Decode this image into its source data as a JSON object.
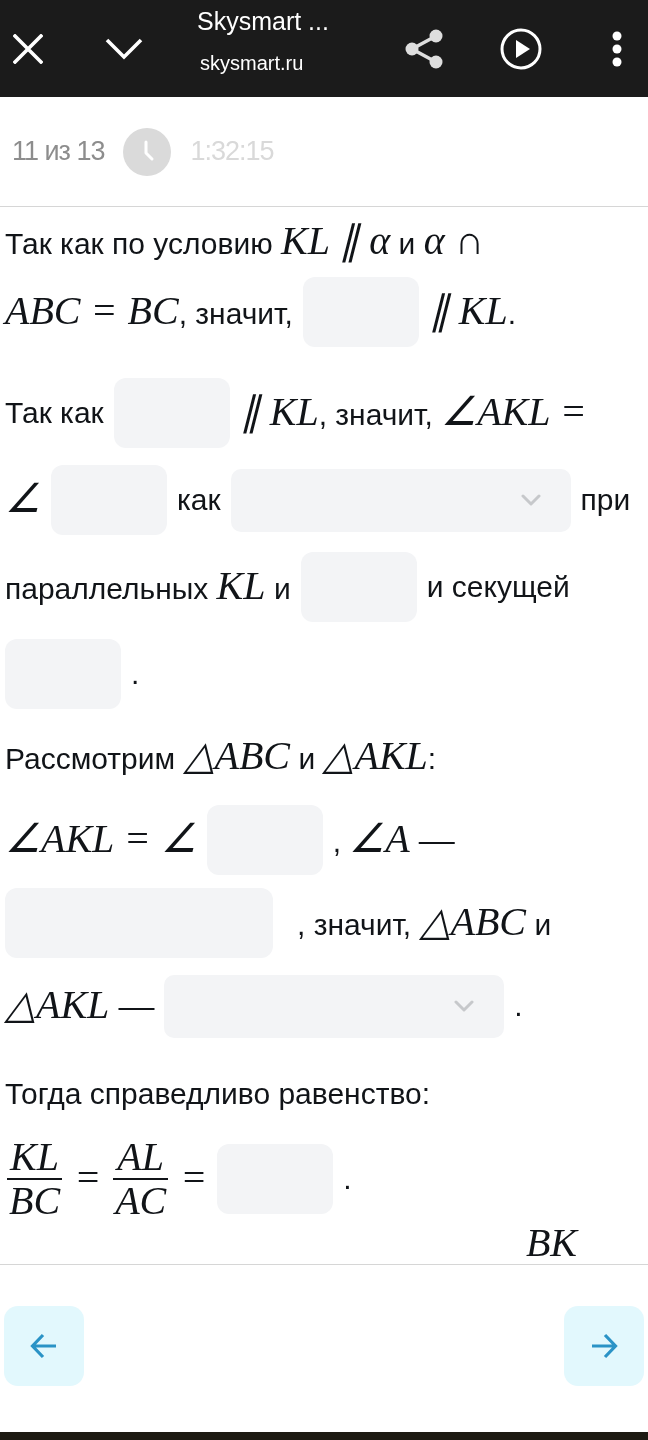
{
  "browser_bar": {
    "title": "Skysmart ...",
    "url": "skysmart.ru"
  },
  "progress": {
    "counter": "11 из 13",
    "timer": "1:32:15"
  },
  "task": {
    "paragraphs": [
      {
        "lines": [
          {
            "items": [
              {
                "kind": "text",
                "text": "Так как по условию *KL ∥ α* и *α ∩*"
              }
            ]
          },
          {
            "items": [
              {
                "kind": "text",
                "text": "*ABC = BC*, значит,"
              },
              {
                "kind": "field"
              },
              {
                "kind": "text",
                "text": "*∥ KL*."
              }
            ]
          }
        ]
      },
      {
        "lines": [
          {
            "items": [
              {
                "kind": "text",
                "text": "Так как"
              },
              {
                "kind": "field"
              },
              {
                "kind": "text",
                "text": "*∥ KL*, значит, *∠AKL =*"
              }
            ]
          },
          {
            "items": [
              {
                "kind": "text",
                "text": "*∠*"
              },
              {
                "kind": "field"
              },
              {
                "kind": "text",
                "text": "как"
              },
              {
                "kind": "select"
              },
              {
                "kind": "text",
                "text": "при"
              }
            ]
          },
          {
            "items": [
              {
                "kind": "text",
                "text": "параллельных *KL* и"
              },
              {
                "kind": "field"
              },
              {
                "kind": "text",
                "text": "и секущей"
              }
            ]
          },
          {
            "items": [
              {
                "kind": "field"
              },
              {
                "kind": "text",
                "text": "."
              }
            ]
          }
        ]
      },
      {
        "lines": [
          {
            "items": [
              {
                "kind": "text",
                "text": "Рассмотрим *△ABC* и *△AKL*:"
              }
            ]
          },
          {
            "items": [
              {
                "kind": "text",
                "text": "*∠AKL = ∠*"
              },
              {
                "kind": "field"
              },
              {
                "kind": "text",
                "text": ", *∠A —*"
              }
            ]
          },
          {
            "items": [
              {
                "kind": "widefield"
              },
              {
                "kind": "text",
                "text": ", значит, *△ABC* и"
              }
            ]
          },
          {
            "items": [
              {
                "kind": "text",
                "text": "*△AKL —*"
              },
              {
                "kind": "select"
              },
              {
                "kind": "text",
                "text": "."
              }
            ]
          }
        ]
      },
      {
        "lines": [
          {
            "items": [
              {
                "kind": "text",
                "text": "Тогда справедливо равенство:"
              }
            ]
          },
          {
            "items": [
              {
                "kind": "fraction",
                "numerator": "KL",
                "denominator": "BC"
              },
              {
                "kind": "text",
                "text": "*=*"
              },
              {
                "kind": "fraction",
                "numerator": "AL",
                "denominator": "AC"
              },
              {
                "kind": "text",
                "text": "*=*"
              },
              {
                "kind": "field"
              },
              {
                "kind": "text",
                "text": "."
              }
            ]
          },
          {
            "items": [
              {
                "kind": "text",
                "text": "*BK*"
              }
            ]
          }
        ]
      }
    ]
  }
}
